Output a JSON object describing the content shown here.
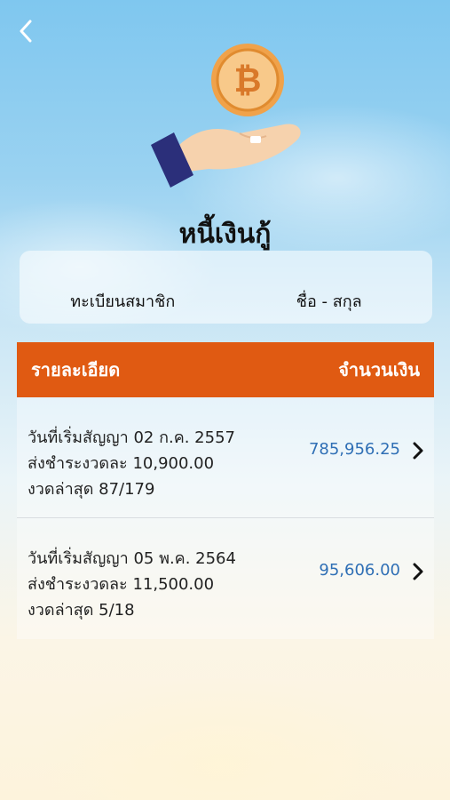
{
  "header": {
    "back_icon": "chevron-left-icon",
    "hero_icon": "hand-receiving-coin-icon",
    "title": "หนี้เงินกู้"
  },
  "member": {
    "id_label": "ทะเบียนสมาชิก",
    "name_label": "ชื่อ - สกุล"
  },
  "table": {
    "col_details": "รายละเอียด",
    "col_amount": "จำนวนเงิน",
    "rows": [
      {
        "start_date": "วันที่เริ่มสัญญา 02 ก.ค. 2557",
        "installment": "ส่งชำระงวดละ 10,900.00",
        "latest": "งวดล่าสุด 87/179",
        "amount": "785,956.25"
      },
      {
        "start_date": "วันที่เริ่มสัญญา 05 พ.ค. 2564",
        "installment": "ส่งชำระงวดละ 11,500.00",
        "latest": "งวดล่าสุด 5/18",
        "amount": "95,606.00"
      }
    ]
  },
  "colors": {
    "header_bg": "#e05a12",
    "amount_text": "#2f6fb5",
    "coin": "#f0a24a",
    "cuff": "#2b2f7a"
  }
}
